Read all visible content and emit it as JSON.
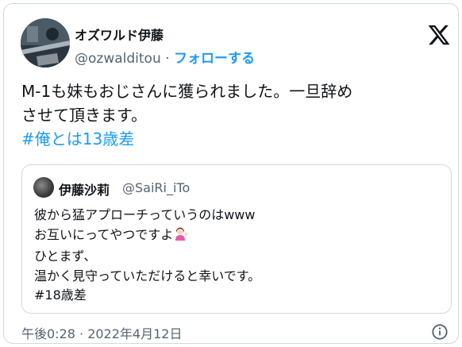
{
  "author": {
    "name": "オズワルド伊藤",
    "handle": "@ozwalditou",
    "separator": " · ",
    "follow_label": "フォローする"
  },
  "tweet": {
    "line1": "M-1も妹もおじさんに獲られました。一旦辞め",
    "line2": "させて頂きます。",
    "hashtag": "#俺とは13歳差"
  },
  "quote": {
    "name": "伊藤沙莉",
    "handle": "@SaiRi_iTo",
    "lines": [
      "彼から猛アプローチっていうのはwww",
      "お互いにってやつですよ",
      "ひとまず、",
      "温かく見守っていただけると幸いです。",
      "#18歳差"
    ]
  },
  "timestamp": "午後0:28 · 2022年4月12日",
  "icons": {
    "x_logo": "x-logo-icon",
    "info": "info-icon",
    "emoji": "person-tipping-hand-emoji"
  },
  "colors": {
    "link": "#1d9bf0",
    "secondary_text": "#536471",
    "border": "#cfd9de",
    "text": "#0f1419"
  }
}
